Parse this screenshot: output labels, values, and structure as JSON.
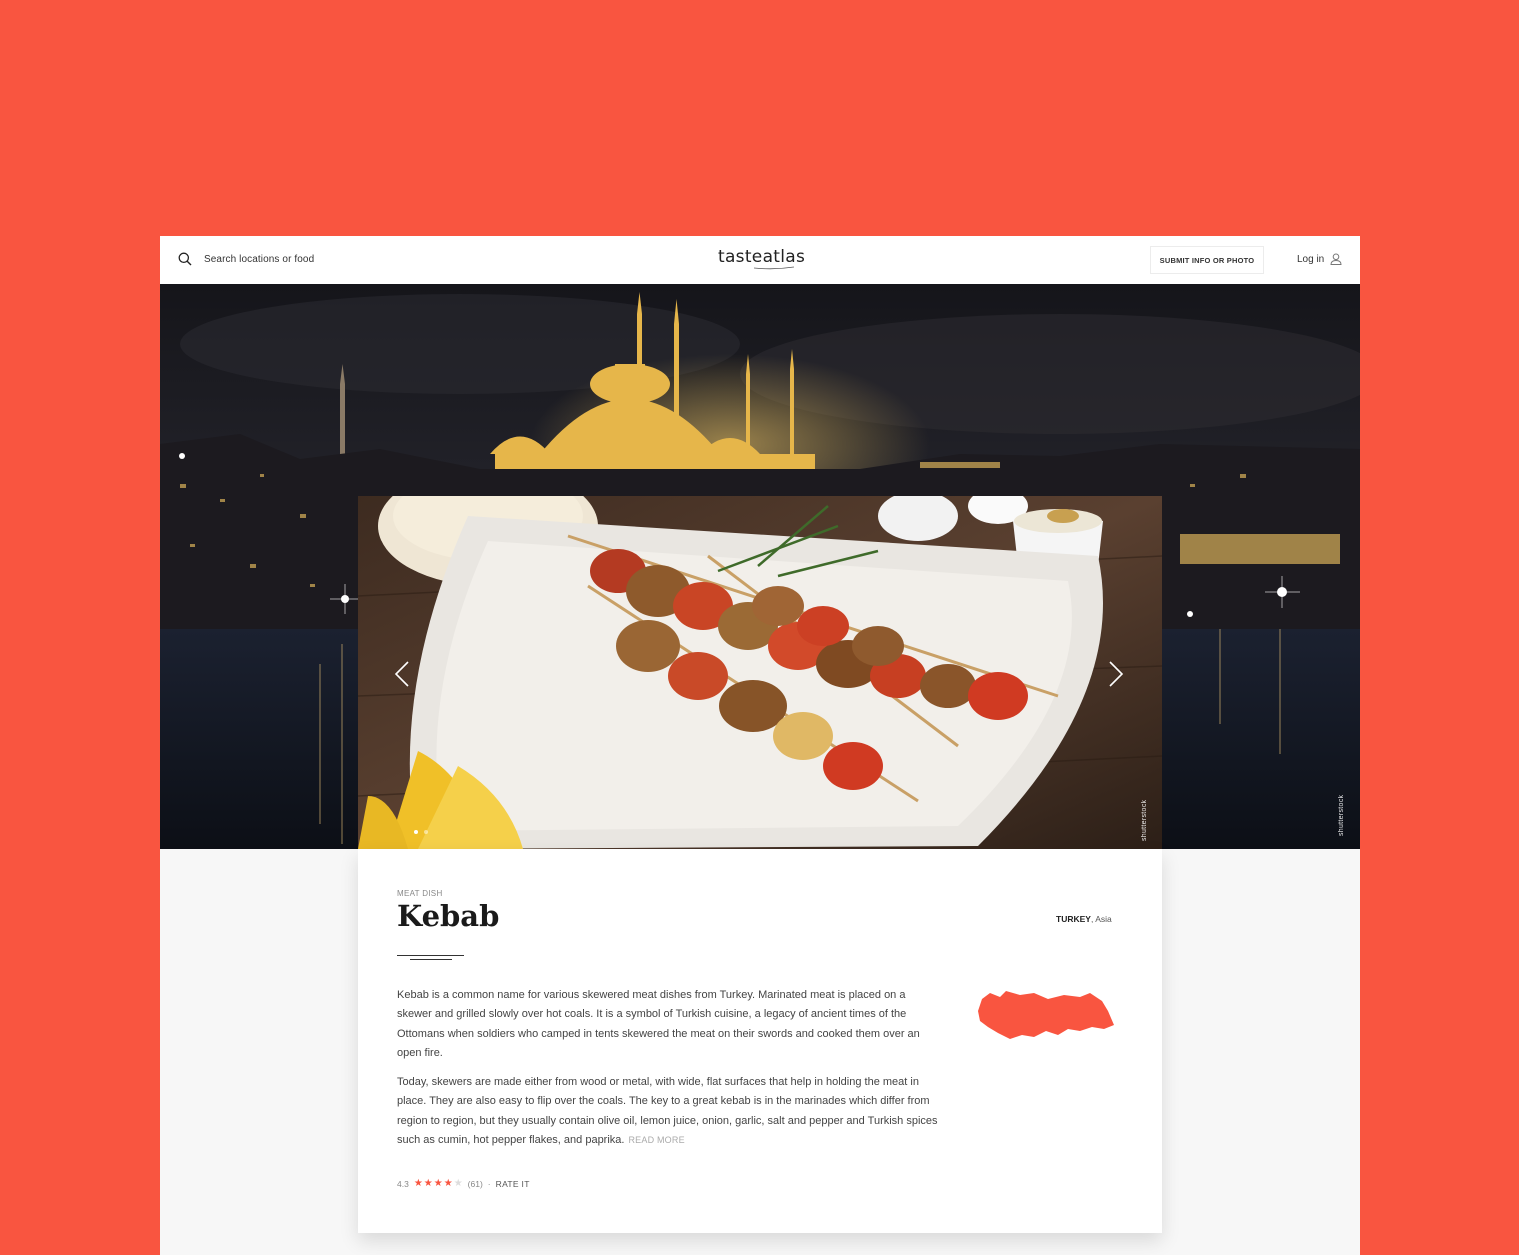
{
  "header": {
    "search_placeholder": "Search locations or food",
    "logo": "tasteatlas",
    "submit_label": "SUBMIT INFO OR PHOTO",
    "login_label": "Log in"
  },
  "hero": {
    "credit_left": "shutterstock",
    "credit_right": "shutterstock",
    "slides_count": 2,
    "active_slide": 1
  },
  "dish": {
    "category": "MEAT DISH",
    "title": "Kebab",
    "country": "TURKEY",
    "region": ", Asia",
    "description": [
      "Kebab is a common name for various skewered meat dishes from Turkey. Marinated meat is placed on a skewer and grilled slowly over hot coals. It is a symbol of Turkish cuisine, a legacy of ancient times of the Ottomans when soldiers who camped in tents skewered the meat on their swords and cooked them over an open fire.",
      "Today, skewers are made either from wood or metal, with wide, flat surfaces that help in holding the meat in place. They are also easy to flip over the coals. The key to a great kebab is in the marinades which differ from region to region, but they usually contain olive oil, lemon juice, onion, garlic, salt and pepper and Turkish spices such as cumin, hot pepper flakes, and paprika."
    ],
    "read_more": "READ MORE",
    "rating": {
      "score": "4.3",
      "stars": 4,
      "max_stars": 5,
      "count": "(61)",
      "separator": "·",
      "rate_label": "RATE IT"
    }
  },
  "colors": {
    "accent": "#f95540",
    "text": "#444444",
    "title": "#1a1a1a"
  }
}
